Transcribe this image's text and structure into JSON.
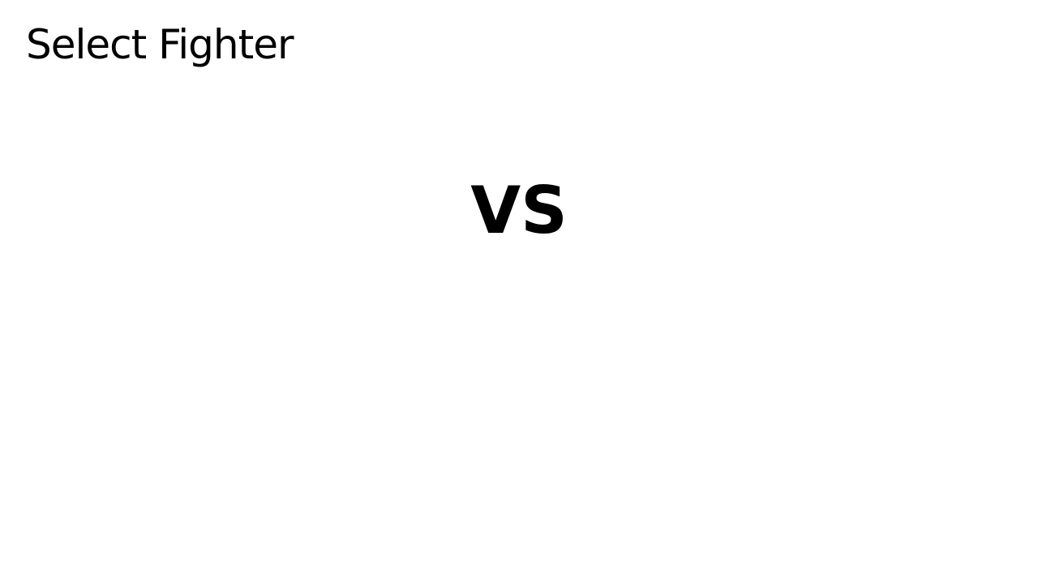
{
  "screen": {
    "title": "Select Fighter",
    "versus_label": "VS",
    "background_color": "#ffffff",
    "text_color": "#000000"
  }
}
